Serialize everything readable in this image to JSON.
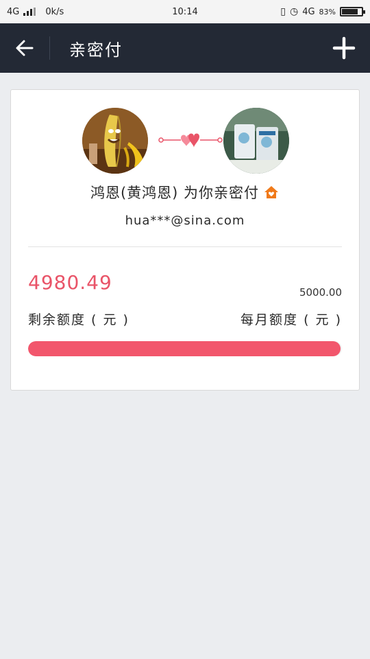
{
  "status_bar": {
    "network_left": "4G",
    "speed": "0k/s",
    "time": "10:14",
    "network_right": "4G",
    "battery": "83%",
    "battery_level": 0.83
  },
  "header": {
    "title": "亲密付",
    "back_icon": "arrow-left-icon",
    "add_icon": "plus-icon"
  },
  "card": {
    "pair_text": "鸿恩(黄鸿恩) 为你亲密付",
    "email": "hua***@sina.com",
    "remaining_amount": "4980.49",
    "monthly_amount": "5000.00",
    "remaining_label": "剩余额度 ( 元 )",
    "monthly_label": "每月额度 ( 元 )",
    "progress_fraction": 0.996,
    "colors": {
      "accent": "#f2566c",
      "header_bg": "#232935",
      "house_icon": "#f07a1a"
    }
  }
}
